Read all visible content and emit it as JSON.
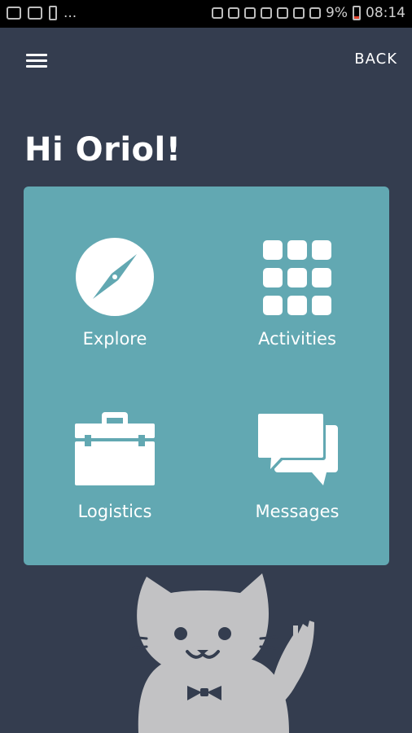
{
  "status_bar": {
    "ellipsis": "...",
    "battery_percent": "9%",
    "time": "08:14",
    "colors": {
      "battery_fill": "#e0402a"
    }
  },
  "top_bar": {
    "menu_icon": "hamburger-menu-icon",
    "back_label": "BACK"
  },
  "greeting": "Hi Oriol!",
  "menu_card": {
    "background": "#62a8b2",
    "tiles": [
      {
        "label": "Explore",
        "icon": "compass-icon"
      },
      {
        "label": "Activities",
        "icon": "grid-icon"
      },
      {
        "label": "Logistics",
        "icon": "briefcase-icon"
      },
      {
        "label": "Messages",
        "icon": "chat-bubbles-icon"
      }
    ]
  },
  "mascot": {
    "icon": "waving-cat-icon"
  },
  "colors": {
    "background": "#343d4f",
    "mascot": "#c2c2c4"
  }
}
